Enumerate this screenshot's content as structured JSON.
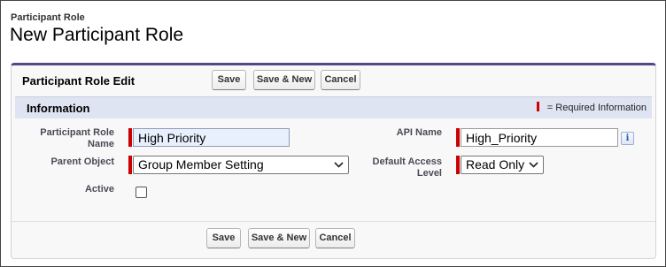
{
  "page": {
    "object_label": "Participant Role",
    "title": "New Participant Role"
  },
  "panel": {
    "title": "Participant Role Edit",
    "buttons": {
      "save": "Save",
      "save_new": "Save & New",
      "cancel": "Cancel"
    }
  },
  "section": {
    "title": "Information",
    "required_legend": "= Required Information"
  },
  "fields": {
    "role_name": {
      "label": "Participant Role Name",
      "value": "High Priority",
      "required": true
    },
    "api_name": {
      "label": "API Name",
      "value": "High_Priority",
      "required": true,
      "help_icon": "info-icon"
    },
    "parent_object": {
      "label": "Parent Object",
      "selected": "Group Member Setting",
      "required": true
    },
    "access_level": {
      "label": "Default Access Level",
      "selected": "Read Only",
      "required": true
    },
    "active": {
      "label": "Active",
      "checked": false
    }
  },
  "colors": {
    "required_marker": "#cc0000",
    "section_bar": "#dfe4f2",
    "panel_accent": "#56458c",
    "focused_input": "#e8f0fe"
  }
}
